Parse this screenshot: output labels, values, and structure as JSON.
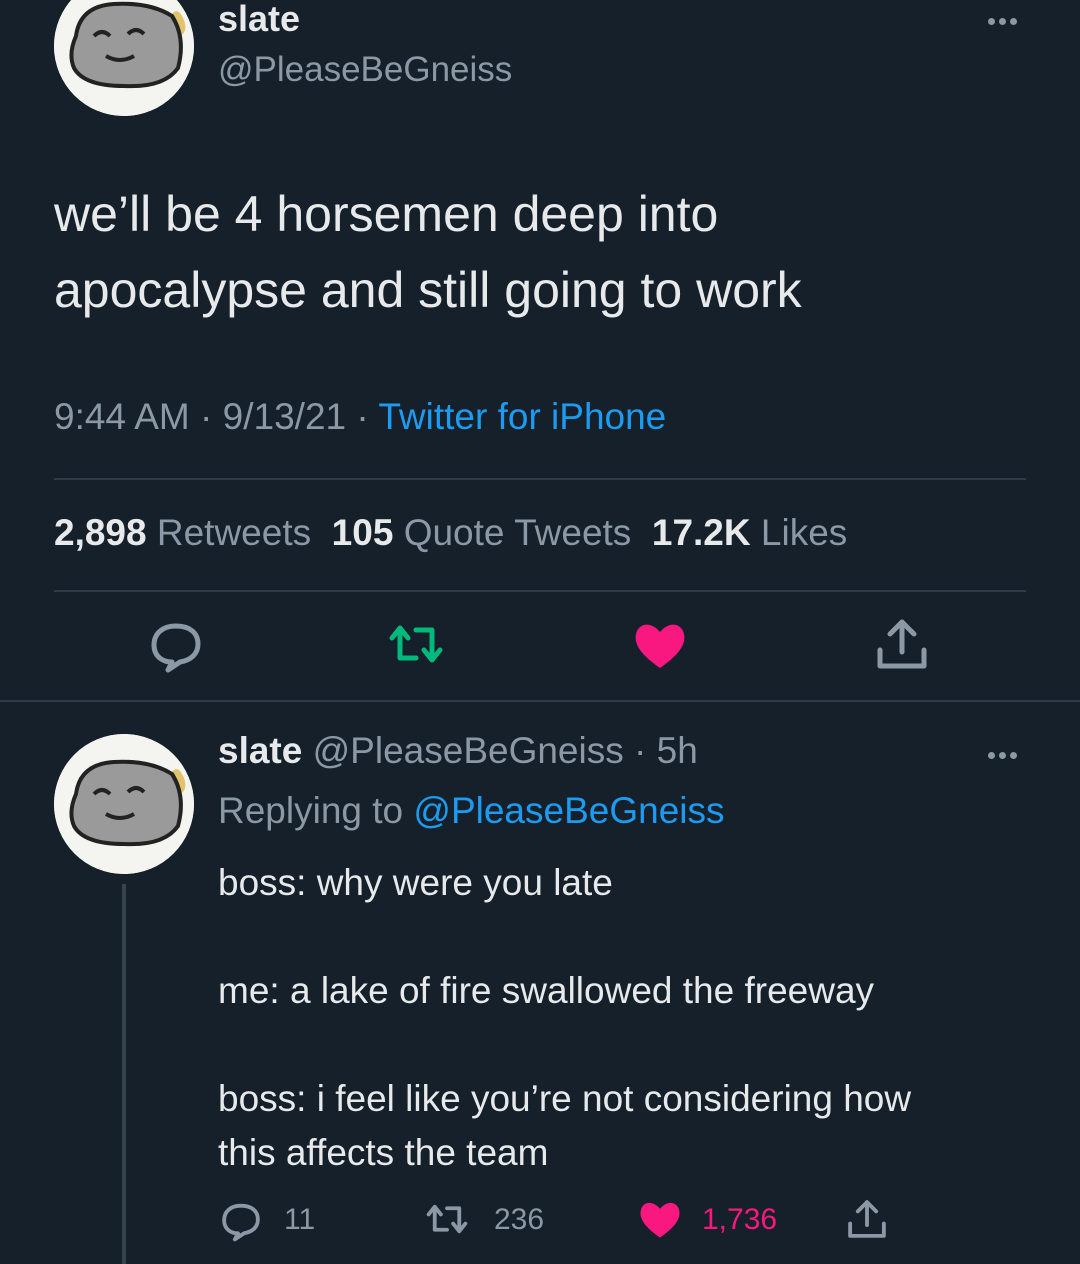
{
  "main_tweet": {
    "display_name": "slate",
    "handle": "@PleaseBeGneiss",
    "text_line1": "we’ll be 4 horsemen deep into",
    "text_line2": "apocalypse and still going to work",
    "time": "9:44 AM",
    "date": "9/13/21",
    "source": "Twitter for iPhone",
    "sep": "·",
    "stats": {
      "retweets_count": "2,898",
      "retweets_label": "Retweets",
      "quotes_count": "105",
      "quotes_label": "Quote Tweets",
      "likes_count": "17.2K",
      "likes_label": "Likes"
    },
    "actions": [
      "reply-icon",
      "retweet-icon",
      "heart-icon",
      "share-icon"
    ]
  },
  "reply_tweet": {
    "display_name": "slate",
    "handle": "@PleaseBeGneiss",
    "age": "5h",
    "sep": "·",
    "replying_label": "Replying to",
    "replying_handle": "@PleaseBeGneiss",
    "line1": "boss: why were you late",
    "line2": "me: a lake of fire swallowed the freeway",
    "line3": "boss: i feel like you’re not considering how",
    "line4": "this affects the team",
    "counts": {
      "replies": "11",
      "retweets": "236",
      "likes": "1,736"
    }
  },
  "colors": {
    "background": "#15202b",
    "text": "#e7e9ea",
    "muted": "#8b98a5",
    "link": "#1d9bf0",
    "retweet_green": "#00ba7c",
    "like_pink": "#f91880"
  }
}
